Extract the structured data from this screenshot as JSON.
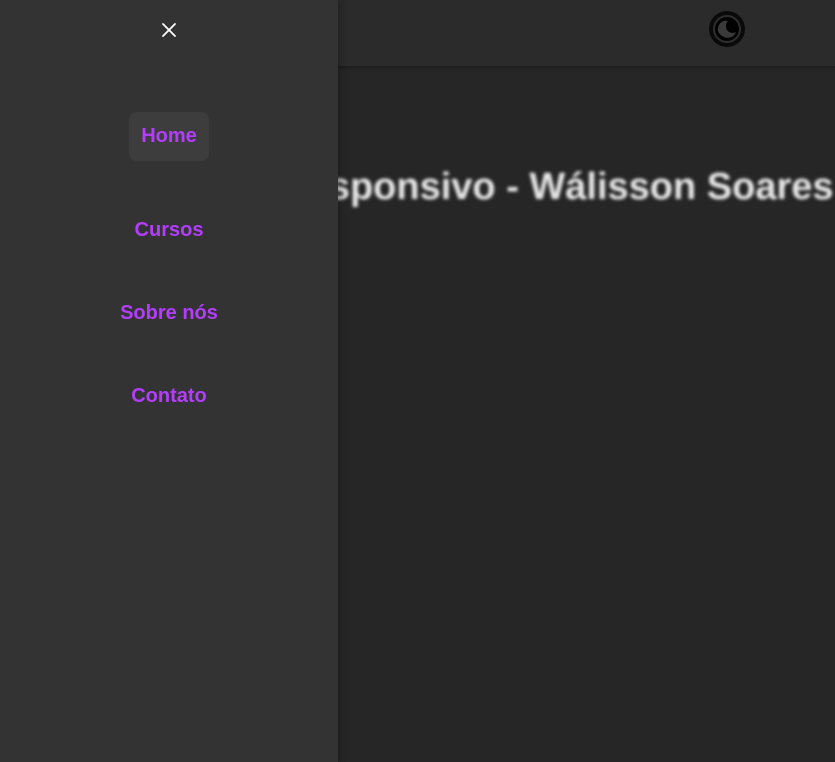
{
  "background": {
    "hero_title": "Site Responsivo - Wálisson Soares"
  },
  "header": {
    "theme_toggle_icon": "theme-toggle-icon"
  },
  "drawer": {
    "close_icon": "close-icon",
    "items": [
      {
        "label": "Home",
        "active": true
      },
      {
        "label": "Cursos",
        "active": false
      },
      {
        "label": "Sobre nós",
        "active": false
      },
      {
        "label": "Contato",
        "active": false
      }
    ]
  },
  "colors": {
    "accent": "#b33dfa",
    "drawer_bg": "#333333",
    "page_bg": "#262626",
    "active_item_bg": "#3d3d3d"
  }
}
